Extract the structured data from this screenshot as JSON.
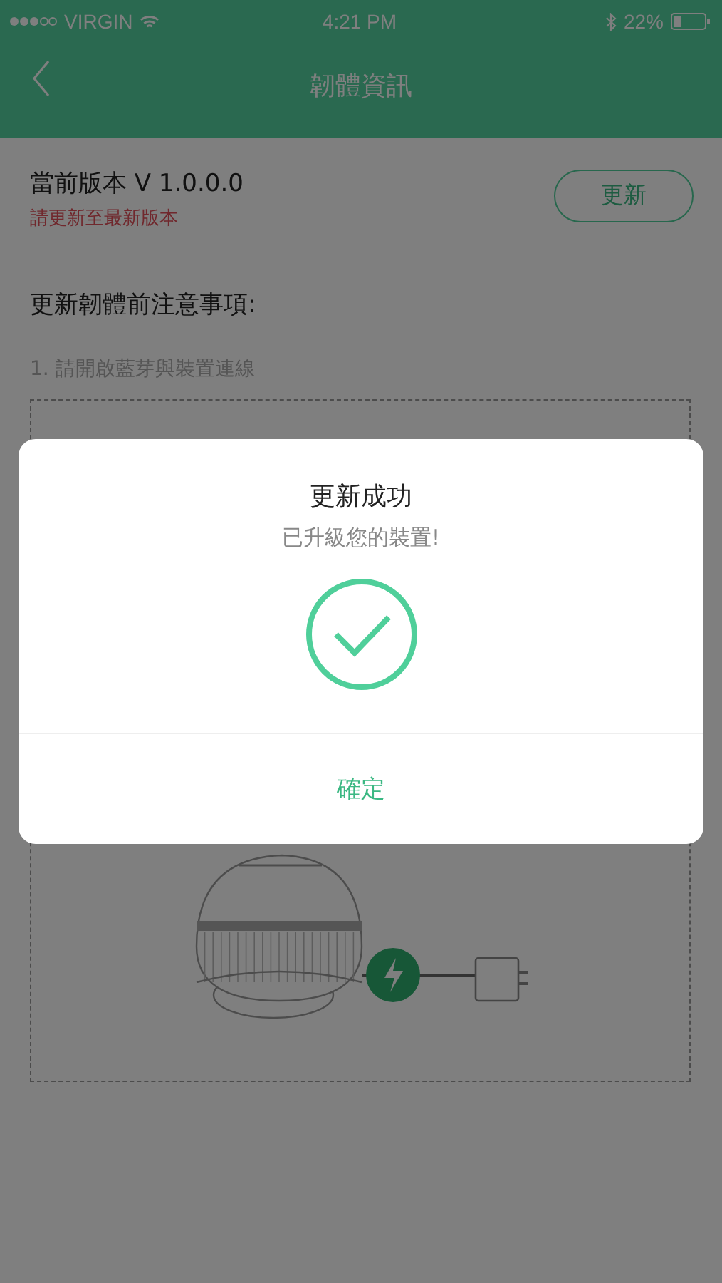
{
  "status_bar": {
    "carrier": "VIRGIN",
    "time": "4:21 PM",
    "battery": "22%"
  },
  "nav": {
    "title": "韌體資訊"
  },
  "firmware": {
    "version": "當前版本 V 1.0.0.0",
    "hint": "請更新至最新版本",
    "update_button": "更新"
  },
  "notes": {
    "heading": "更新韌體前注意事項:",
    "items": [
      "1. 請開啟藍芽與裝置連線"
    ]
  },
  "dialog": {
    "title": "更新成功",
    "message": "已升級您的裝置!",
    "confirm": "確定"
  }
}
